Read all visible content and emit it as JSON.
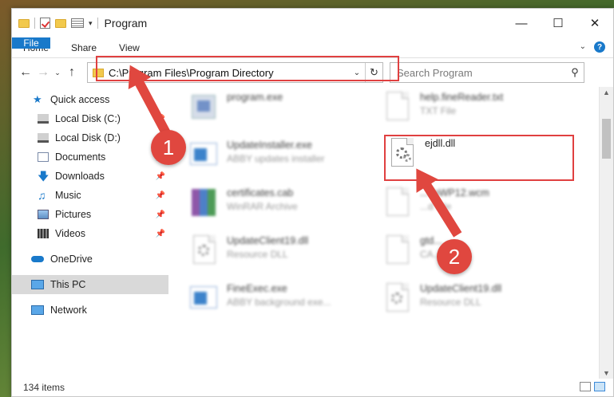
{
  "window": {
    "title": "Program"
  },
  "ribbon": {
    "tabs": [
      "File",
      "Home",
      "Share",
      "View"
    ],
    "help": "?"
  },
  "address": {
    "path": "C:\\Program Files\\Program Directory",
    "search_placeholder": "Search Program"
  },
  "sidebar": {
    "items": [
      {
        "label": "Quick access",
        "icon": "star-icon"
      },
      {
        "label": "Local Disk (C:)",
        "icon": "drive-icon"
      },
      {
        "label": "Local Disk (D:)",
        "icon": "drive-icon"
      },
      {
        "label": "Documents",
        "icon": "documents-icon"
      },
      {
        "label": "Downloads",
        "icon": "download-icon"
      },
      {
        "label": "Music",
        "icon": "music-icon"
      },
      {
        "label": "Pictures",
        "icon": "pictures-icon"
      },
      {
        "label": "Videos",
        "icon": "videos-icon"
      },
      {
        "label": "OneDrive",
        "icon": "onedrive-icon"
      },
      {
        "label": "This PC",
        "icon": "computer-icon"
      },
      {
        "label": "Network",
        "icon": "network-icon"
      }
    ]
  },
  "files": [
    {
      "name": "program.exe",
      "type": ""
    },
    {
      "name": "help.fineReader.txt",
      "type": "TXT File"
    },
    {
      "name": "UpdateInstaller.exe",
      "type": "ABBY updates installer"
    },
    {
      "name": "ejdll.dll",
      "type": ""
    },
    {
      "name": "certificates.cab",
      "type": "WinRAR Archive"
    },
    {
      "name": "...ToWP12.wcm",
      "type": "...d File"
    },
    {
      "name": "UpdateClient19.dll",
      "type": "Resource DLL"
    },
    {
      "name": "gtd...",
      "type": "CA..."
    },
    {
      "name": "FineExec.exe",
      "type": "ABBY background exe..."
    },
    {
      "name": "UpdateClient19.dll",
      "type": "Resource DLL"
    }
  ],
  "annotations": {
    "step1": "1",
    "step2": "2",
    "color": "#e0473f"
  },
  "status": {
    "items_count": "134 items"
  }
}
